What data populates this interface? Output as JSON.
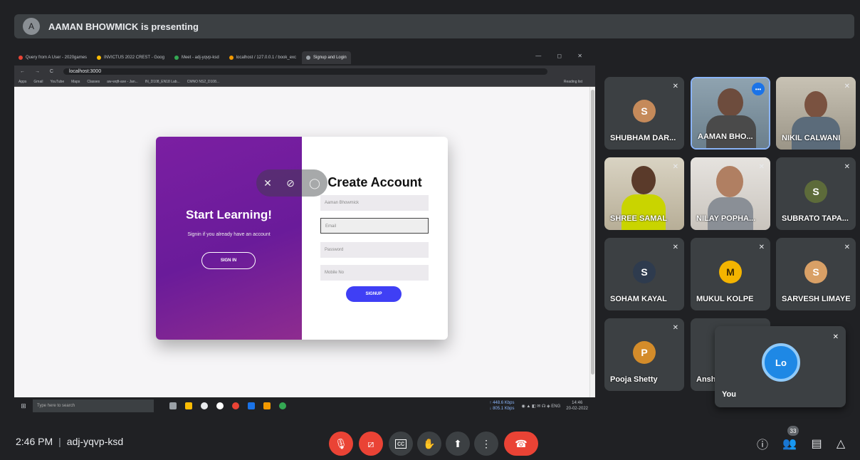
{
  "presenter": {
    "initial": "A",
    "text": "AAMAN BHOWMICK is presenting"
  },
  "browser": {
    "tabs": [
      "Query from A User - 2020games",
      "INVICTUS 2022 CREST - Goog",
      "Meet - adj-yqvp-ksd",
      "localhost / 127.0.0.1 / book_exc",
      "Signup and Login"
    ],
    "window_controls": "— ◻ ✕",
    "nav": "← → C",
    "url": "localhost:3000",
    "bookmarks": [
      "Apps",
      "Gmail",
      "YouTube",
      "Maps",
      "Classes",
      "aw-wqft-axe - Jan...",
      "IN_D108_EN18 Lab...",
      "CMNO NS2_D108..."
    ],
    "reading_list": "Reading list"
  },
  "signup_page": {
    "left_heading": "Start Learning!",
    "left_text": "Signin if you already have an account",
    "signin_button": "SIGN IN",
    "right_heading": "Create Account",
    "fields": [
      {
        "value": "Aaman Bhowmick"
      },
      {
        "value": "Email"
      },
      {
        "value": "Password"
      },
      {
        "value": "Mobile No"
      }
    ],
    "signup_button": "SIGNUP"
  },
  "taskbar": {
    "search_placeholder": "Type here to search",
    "net_up": "↑ 448.6 Kbps",
    "net_down": "↓ 805.1 Kbps",
    "lang": "ENG",
    "time": "14:46",
    "date": "20-02-2022"
  },
  "participants": [
    {
      "name": "SHUBHAM DAR...",
      "initial": "S",
      "color": "#c58a5a"
    },
    {
      "name": "AAMAN BHO..."
    },
    {
      "name": "NIKIL CALWANI"
    },
    {
      "name": "SHREE SAMAL"
    },
    {
      "name": "NILAY POPHA..."
    },
    {
      "name": "SUBRATO TAPA...",
      "initial": "S",
      "color": "#5d6b3a"
    },
    {
      "name": "SOHAM KAYAL",
      "initial": "S",
      "color": "#2e3b4e"
    },
    {
      "name": "MUKUL KOLPE",
      "initial": "M",
      "color": "#f4b400"
    },
    {
      "name": "SARVESH LIMAYE",
      "initial": "S",
      "color": "#d9a066"
    },
    {
      "name": "Pooja Shetty",
      "initial": "P",
      "color": "#d48c2a"
    },
    {
      "name": "Ansh"
    }
  ],
  "self_view": {
    "name": "You",
    "logo_text": "Lo"
  },
  "meeting": {
    "time": "2:46 PM",
    "separator": "|",
    "code": "adj-yqvp-ksd",
    "people_count": "33"
  },
  "icons": {
    "mic_off": "mic-off-icon",
    "cam_off": "camera-off-icon",
    "captions": "captions-icon",
    "hand": "raise-hand-icon",
    "present": "present-icon",
    "more": "more-vert-icon",
    "leave": "call-end-icon",
    "info": "info-icon",
    "people": "people-icon",
    "chat": "chat-icon",
    "activities": "activities-icon"
  },
  "colors": {
    "accent_red": "#ea4335",
    "accent_blue": "#1a73e8",
    "purple": "#7b1fa2",
    "signup_blue": "#3f3ff5"
  }
}
